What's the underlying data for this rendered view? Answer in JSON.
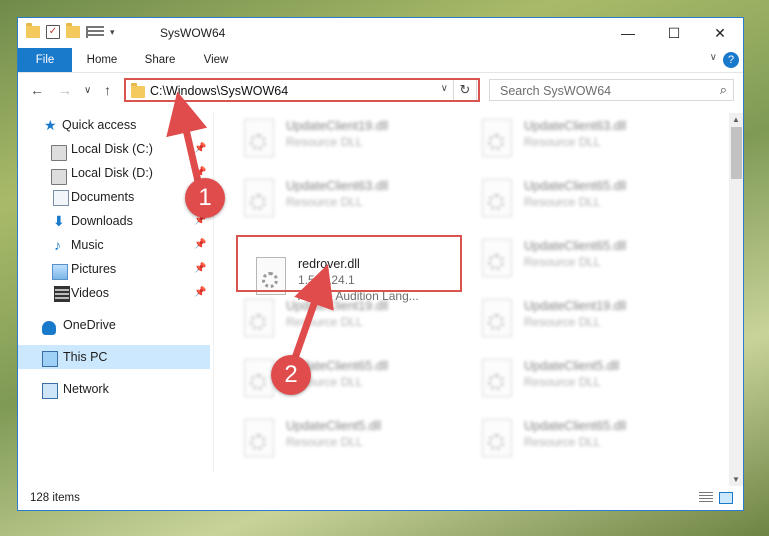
{
  "window": {
    "title": "SysWOW64",
    "controls": {
      "minimize": "—",
      "maximize": "☐",
      "close": "✕"
    }
  },
  "ribbon": {
    "tabs": [
      {
        "label": "File",
        "active": true
      },
      {
        "label": "Home"
      },
      {
        "label": "Share"
      },
      {
        "label": "View"
      }
    ],
    "help": "?",
    "collapse": "∨"
  },
  "nav": {
    "back": "←",
    "forward": "→",
    "recent": "∨",
    "up": "↑",
    "address": "C:\\Windows\\SysWOW64",
    "address_dropdown": "∨",
    "refresh": "↻",
    "search_placeholder": "Search SysWOW64",
    "search_icon": "search-icon"
  },
  "sidebar": {
    "items": [
      {
        "label": "Quick access",
        "icon": "star-icon"
      },
      {
        "label": "Local Disk (C:)",
        "icon": "disk-icon",
        "pinned": true
      },
      {
        "label": "Local Disk (D:)",
        "icon": "disk-icon",
        "pinned": true
      },
      {
        "label": "Documents",
        "icon": "documents-icon",
        "pinned": true
      },
      {
        "label": "Downloads",
        "icon": "downloads-icon",
        "pinned": true
      },
      {
        "label": "Music",
        "icon": "music-icon",
        "pinned": true
      },
      {
        "label": "Pictures",
        "icon": "pictures-icon",
        "pinned": true
      },
      {
        "label": "Videos",
        "icon": "videos-icon",
        "pinned": true
      },
      {
        "label": "OneDrive",
        "icon": "onedrive-icon"
      },
      {
        "label": "This PC",
        "icon": "this-pc-icon",
        "selected": true
      },
      {
        "label": "Network",
        "icon": "network-icon"
      }
    ],
    "pin_glyph": "📌"
  },
  "files": [
    {
      "name": "UpdateClient19.dll",
      "type": "Resource DLL"
    },
    {
      "name": "UpdateClient63.dll",
      "type": "Resource DLL"
    },
    {
      "name": "UpdateClient63.dll",
      "type": "Resource DLL"
    },
    {
      "name": "UpdateClient65.dll",
      "type": "Resource DLL"
    },
    {
      "name": "redrover.dll",
      "version": "1.5.4124.1",
      "description": "Adobe Audition Lang...",
      "highlighted": true
    },
    {
      "name": "UpdateClient65.dll",
      "type": "Resource DLL"
    },
    {
      "name": "UpdateClient19.dll",
      "type": "Resource DLL"
    },
    {
      "name": "UpdateClient19.dll",
      "type": "Resource DLL"
    },
    {
      "name": "UpdateClient65.dll",
      "type": "Resource DLL"
    },
    {
      "name": "UpdateClient5.dll",
      "type": "Resource DLL"
    },
    {
      "name": "UpdateClient5.dll",
      "type": "Resource DLL"
    },
    {
      "name": "UpdateClient65.dll",
      "type": "Resource DLL"
    }
  ],
  "status": {
    "item_count": "128 items"
  },
  "annotations": {
    "step1": "1",
    "step2": "2",
    "accent": "#e04b4b"
  }
}
